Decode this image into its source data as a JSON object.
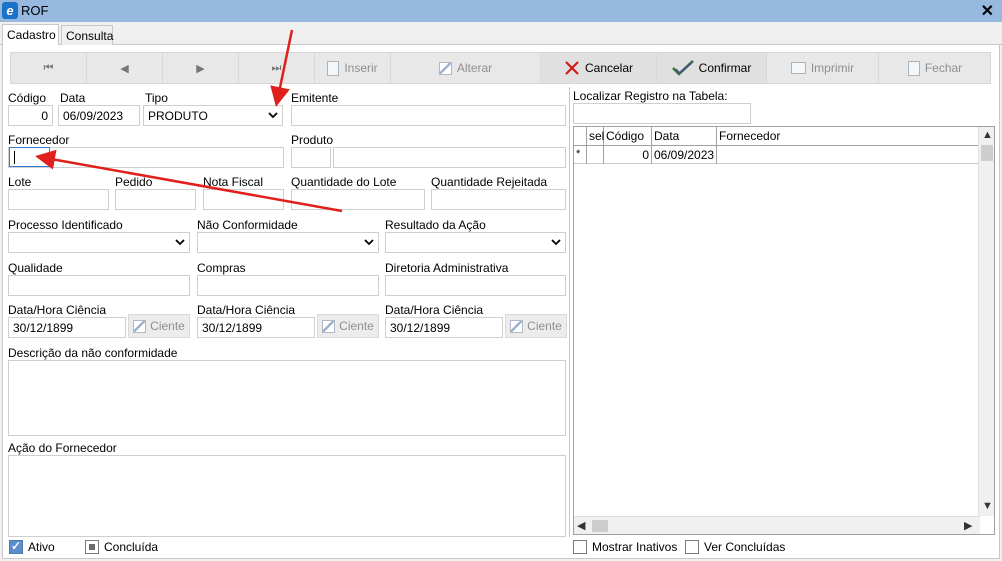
{
  "window": {
    "title": "ROF",
    "icon": "app-icon",
    "close_label": "✕"
  },
  "tabs": [
    {
      "label": "Cadastro"
    },
    {
      "label": "Consulta"
    }
  ],
  "toolbar": {
    "first": "⏮",
    "prev": "◀",
    "next": "▶",
    "last": "⏭",
    "inserir": "Inserir",
    "alterar": "Alterar",
    "cancelar": "Cancelar",
    "confirmar": "Confirmar",
    "imprimir": "Imprimir",
    "fechar": "Fechar"
  },
  "form": {
    "codigo": {
      "label": "Código",
      "value": "0"
    },
    "data": {
      "label": "Data",
      "value": "06/09/2023"
    },
    "tipo": {
      "label": "Tipo",
      "value": "PRODUTO"
    },
    "emitente": {
      "label": "Emitente",
      "value": ""
    },
    "fornecedor": {
      "label": "Fornecedor",
      "value": ""
    },
    "produto": {
      "label": "Produto",
      "value": ""
    },
    "lote": {
      "label": "Lote"
    },
    "pedido": {
      "label": "Pedido"
    },
    "nota_fiscal": {
      "label": "Nota Fiscal"
    },
    "quantidade_lote": {
      "label": "Quantidade do Lote"
    },
    "quantidade_rejeitada": {
      "label": "Quantidade Rejeitada"
    },
    "processo": {
      "label": "Processo Identificado"
    },
    "nao_conformidade": {
      "label": "Não Conformidade"
    },
    "resultado": {
      "label": "Resultado da Ação"
    },
    "qualidade": {
      "label": "Qualidade"
    },
    "compras": {
      "label": "Compras"
    },
    "diretoria": {
      "label": "Diretoria Administrativa"
    },
    "ciencia_1": {
      "label": "Data/Hora Ciência",
      "value": "30/12/1899"
    },
    "ciencia_2": {
      "label": "Data/Hora Ciência",
      "value": "30/12/1899"
    },
    "ciencia_3": {
      "label": "Data/Hora Ciência",
      "value": "30/12/1899"
    },
    "ciente_label": "Ciente",
    "descricao": {
      "label": "Descrição da não conformidade"
    },
    "acao": {
      "label": "Ação do Fornecedor"
    },
    "ativo": {
      "label": "Ativo",
      "checked": true
    },
    "concluida": {
      "label": "Concluída",
      "checked": "partial"
    }
  },
  "search": {
    "label": "Localizar Registro na Tabela:",
    "value": ""
  },
  "table": {
    "columns": [
      "sel",
      "Código",
      "Data",
      "Fornecedor"
    ],
    "rows": [
      {
        "indicator": "*",
        "sel": "",
        "codigo": "0",
        "data": "06/09/2023",
        "fornecedor": ""
      }
    ]
  },
  "bottom_right": {
    "mostrar_inativos": {
      "label": "Mostrar Inativos",
      "checked": false
    },
    "ver_concluidas": {
      "label": "Ver Concluídas",
      "checked": false
    }
  },
  "annotations": {
    "arrow_color": "#e0201c"
  },
  "colors": {
    "titlebar": "#97b9e0",
    "accent": "#1a73c9"
  }
}
